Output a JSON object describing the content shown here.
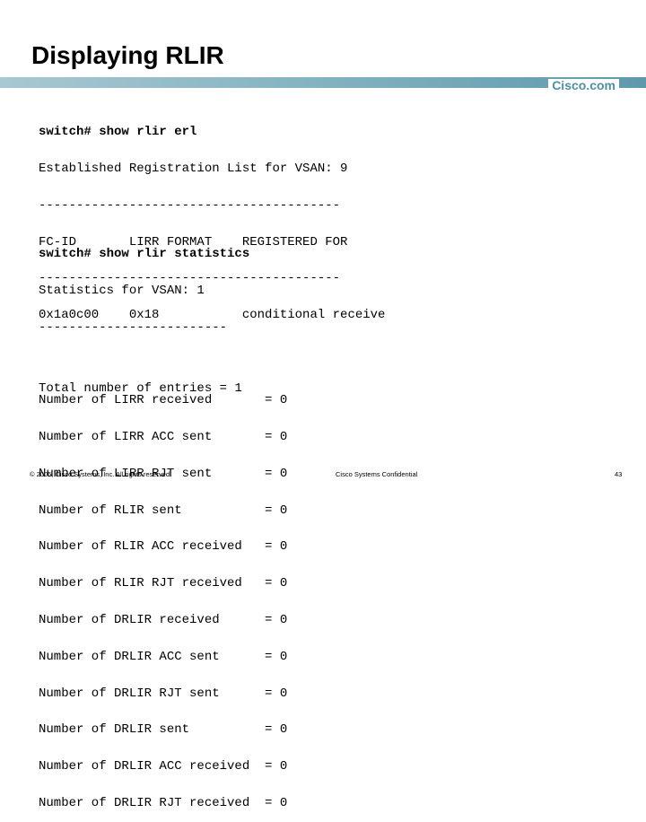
{
  "slide": {
    "title": "Displaying RLIR",
    "logo": "Cisco.com"
  },
  "terminal_block_1": {
    "command": "switch# show rlir erl",
    "lines": [
      "Established Registration List for VSAN: 9",
      "----------------------------------------",
      "FC-ID       LIRR FORMAT    REGISTERED FOR",
      "----------------------------------------",
      "0x1a0c00    0x18           conditional receive",
      "",
      "Total number of entries = 1"
    ]
  },
  "terminal_block_2": {
    "command": "switch# show rlir statistics",
    "lines": [
      "Statistics for VSAN: 1",
      "-------------------------",
      "",
      "Number of LIRR received       = 0",
      "Number of LIRR ACC sent       = 0",
      "Number of LIRR RJT sent       = 0",
      "Number of RLIR sent           = 0",
      "Number of RLIR ACC received   = 0",
      "Number of RLIR RJT received   = 0",
      "Number of DRLIR received      = 0",
      "Number of DRLIR ACC sent      = 0",
      "Number of DRLIR RJT sent      = 0",
      "Number of DRLIR sent          = 0",
      "Number of DRLIR ACC received  = 0",
      "Number of DRLIR RJT received  = 0"
    ]
  },
  "footer": {
    "copyright": "© 2005, Cisco Systems, Inc. All rights reserved.",
    "confidential": "Cisco Systems Confidential",
    "page_number": "43"
  }
}
